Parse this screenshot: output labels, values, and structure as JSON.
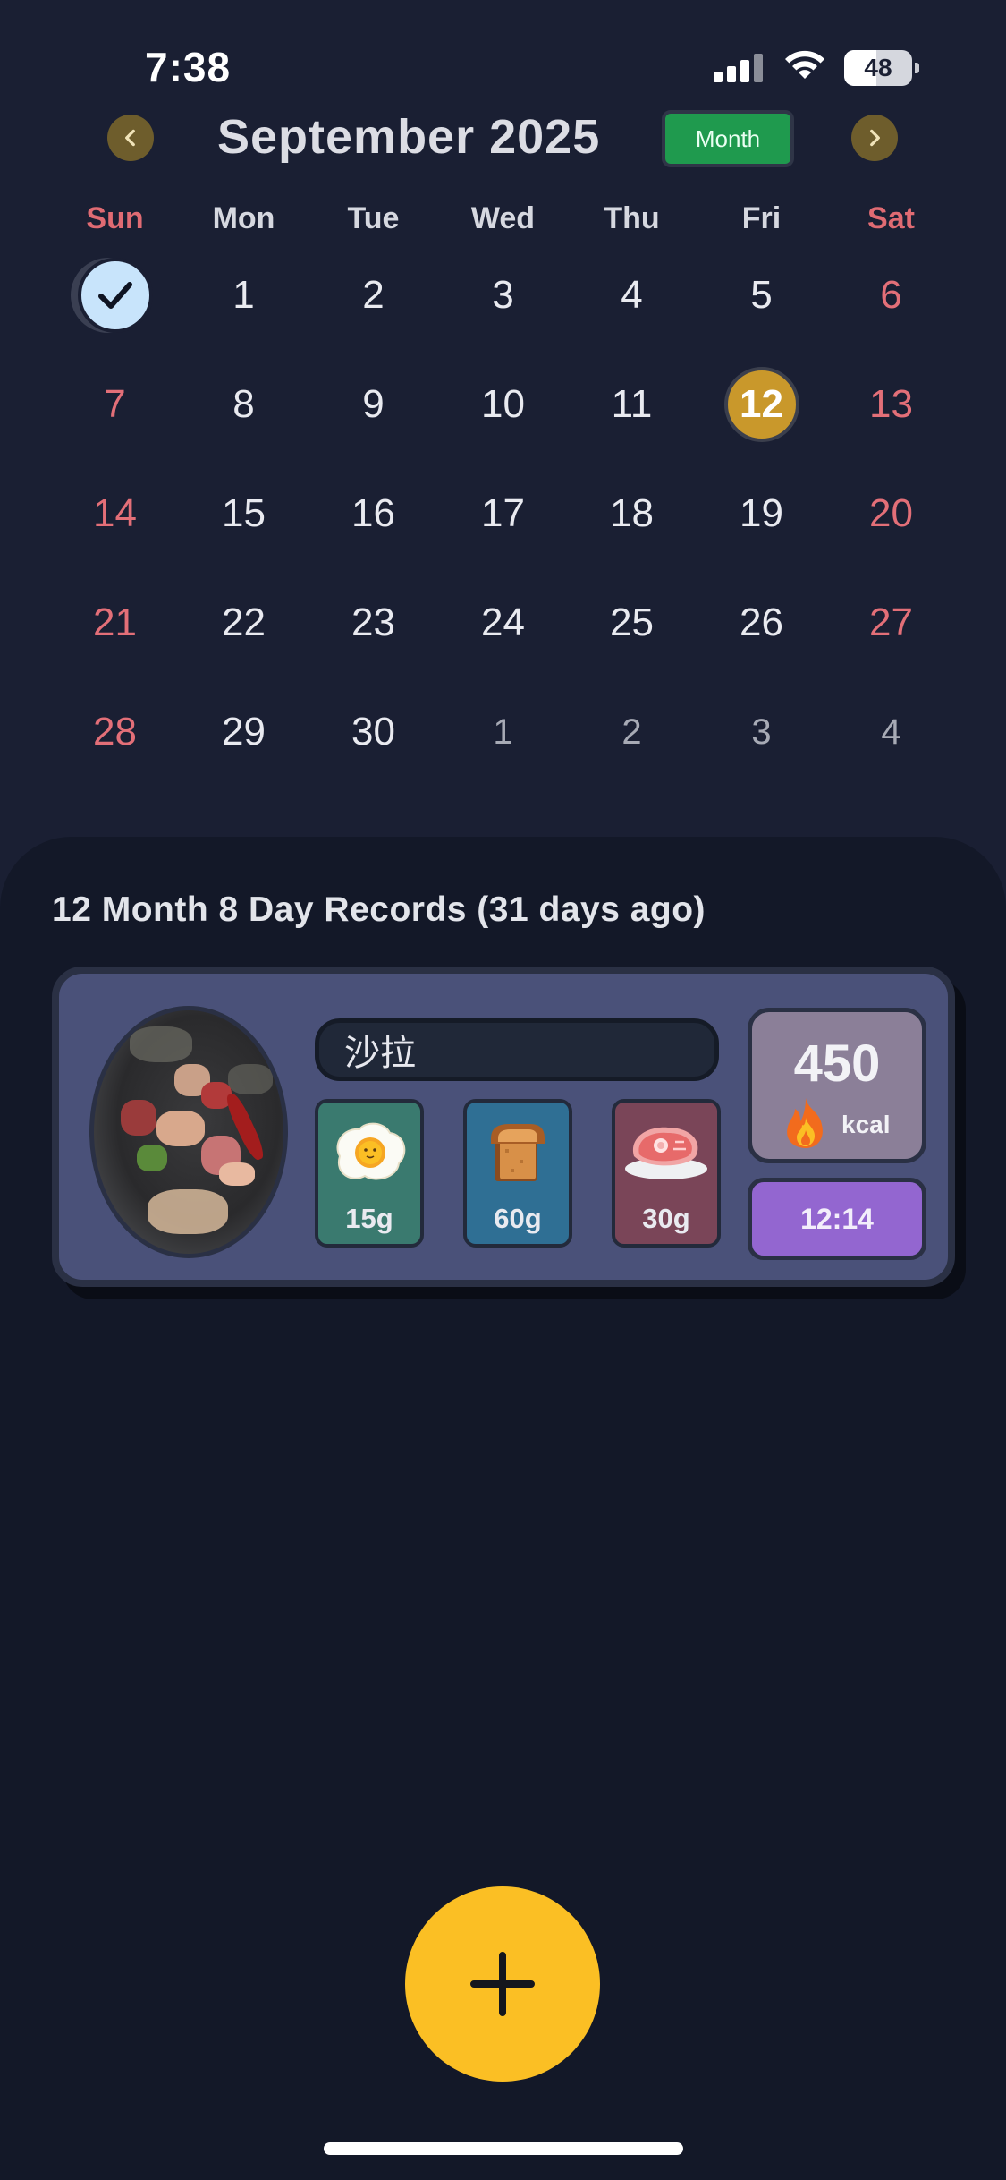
{
  "status_bar": {
    "time": "7:38",
    "battery": "48",
    "battery_level": 0.48
  },
  "calendar": {
    "title": "September 2025",
    "view_toggle": "Month",
    "prev_icon": "chevron-left-icon",
    "next_icon": "chevron-right-icon",
    "weekdays": [
      "Sun",
      "Mon",
      "Tue",
      "Wed",
      "Thu",
      "Fri",
      "Sat"
    ],
    "weeks": [
      [
        "✓",
        "1",
        "2",
        "3",
        "4",
        "5",
        "6"
      ],
      [
        "7",
        "8",
        "9",
        "10",
        "11",
        "12",
        "13"
      ],
      [
        "14",
        "15",
        "16",
        "17",
        "18",
        "19",
        "20"
      ],
      [
        "21",
        "22",
        "23",
        "24",
        "25",
        "26",
        "27"
      ],
      [
        "28",
        "29",
        "30",
        "1",
        "2",
        "3",
        "4"
      ]
    ],
    "selected_day": "12",
    "selected_color": "#c9982b"
  },
  "records": {
    "title": "12 Month 8 Day Records (31 days ago)",
    "items": [
      {
        "name": "沙拉",
        "photo_icon": "food-photo",
        "protein": {
          "icon": "fried-egg-icon",
          "value": "15g"
        },
        "carbs": {
          "icon": "bread-icon",
          "value": "60g"
        },
        "fat": {
          "icon": "steak-icon",
          "value": "30g"
        },
        "kcal": {
          "value": "450",
          "unit": "kcal",
          "icon": "flame-icon"
        },
        "time": "12:14"
      }
    ]
  },
  "fab": {
    "icon": "plus-icon"
  },
  "colors": {
    "background": "#1a1f33",
    "panel": "#131828",
    "accent": "#fbbf24",
    "weekend": "#e06b73",
    "toggle": "#1f9a4e"
  }
}
